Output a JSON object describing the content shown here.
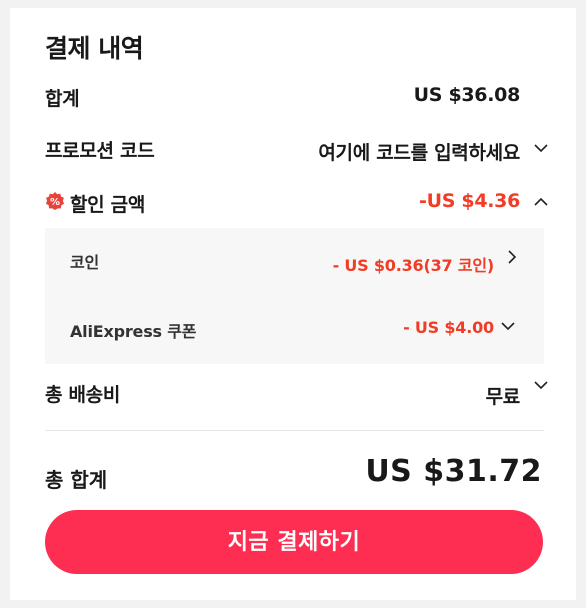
{
  "summary": {
    "title": "결제 내역",
    "subtotal_label": "합계",
    "subtotal_value": "US $36.08",
    "promo_label": "프로모션 코드",
    "promo_placeholder": "여기에 코드를 입력하세요",
    "discount_label": "할인 금액",
    "discount_value": "-US $4.36",
    "discount_icon": "%",
    "discount_items": [
      {
        "label": "코인",
        "value": "- US $0.36(37 코인)"
      },
      {
        "label": "AliExpress 쿠폰",
        "value": "- US $4.00"
      }
    ],
    "shipping_label": "총 배송비",
    "shipping_value": "무료",
    "total_label": "총 합계",
    "total_value": "US $31.72",
    "pay_button_label": "지금 결제하기"
  },
  "colors": {
    "accent_red": "#f13c26",
    "button": "#fe2d52",
    "badge": "#e8433a"
  }
}
